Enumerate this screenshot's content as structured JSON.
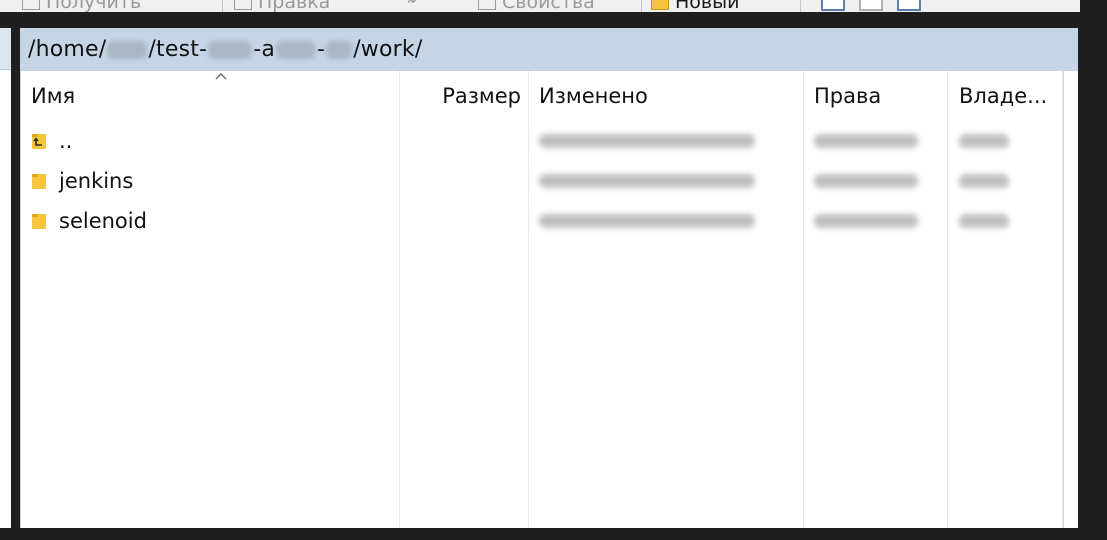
{
  "toolbar": {
    "items": [
      {
        "label": "Получить",
        "icon": "download-icon"
      },
      {
        "label": "Правка",
        "icon": "edit-icon"
      },
      {
        "label": "Свойства",
        "icon": "properties-icon"
      },
      {
        "label": "Новый",
        "icon": "folder-icon"
      }
    ]
  },
  "path": {
    "segments": [
      "/home/",
      "/test-",
      "-a",
      "-",
      "/work/"
    ]
  },
  "columns": {
    "name": "Имя",
    "size": "Размер",
    "modified": "Изменено",
    "rights": "Права",
    "owner": "Владе..."
  },
  "files": [
    {
      "name": "..",
      "icon": "parent-directory-icon"
    },
    {
      "name": "jenkins",
      "icon": "folder-icon"
    },
    {
      "name": "selenoid",
      "icon": "folder-icon"
    }
  ],
  "colors": {
    "path_bar_bg": "#c5d5e6",
    "folder_yellow": "#f5c542",
    "frame_dark": "#1e1e1e"
  }
}
